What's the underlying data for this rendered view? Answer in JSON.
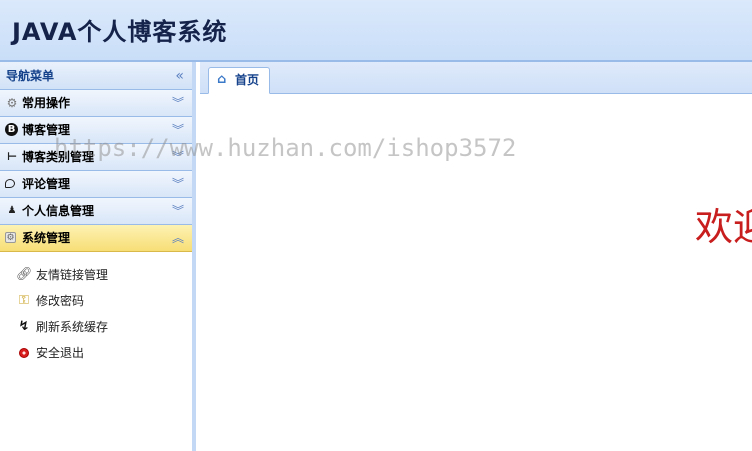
{
  "header": {
    "title": "JAVA个人博客系统"
  },
  "sidebar": {
    "title": "导航菜单",
    "collapse_icon": "double-chevron-left-icon",
    "panels": [
      {
        "label": "常用操作",
        "icon": "gear-icon",
        "expanded": false
      },
      {
        "label": "博客管理",
        "icon": "blog-b-icon",
        "expanded": false
      },
      {
        "label": "博客类别管理",
        "icon": "category-tree-icon",
        "expanded": false
      },
      {
        "label": "评论管理",
        "icon": "comment-bubble-icon",
        "expanded": false
      },
      {
        "label": "个人信息管理",
        "icon": "user-icon",
        "expanded": false
      },
      {
        "label": "系统管理",
        "icon": "system-settings-icon",
        "expanded": true
      }
    ],
    "system_items": [
      {
        "label": "友情链接管理",
        "icon": "link-icon"
      },
      {
        "label": "修改密码",
        "icon": "key-folder-icon"
      },
      {
        "label": "刷新系统缓存",
        "icon": "refresh-icon"
      },
      {
        "label": "安全退出",
        "icon": "exit-icon"
      }
    ]
  },
  "tabs": [
    {
      "label": "首页",
      "icon": "home-icon",
      "active": true
    }
  ],
  "main": {
    "welcome_text": "欢迎使用"
  },
  "watermark": "https://www.huzhan.com/ishop3572",
  "colors": {
    "accent_border": "#99bbe8",
    "active_panel": "#f7de76",
    "welcome_red": "#c81e1e"
  }
}
